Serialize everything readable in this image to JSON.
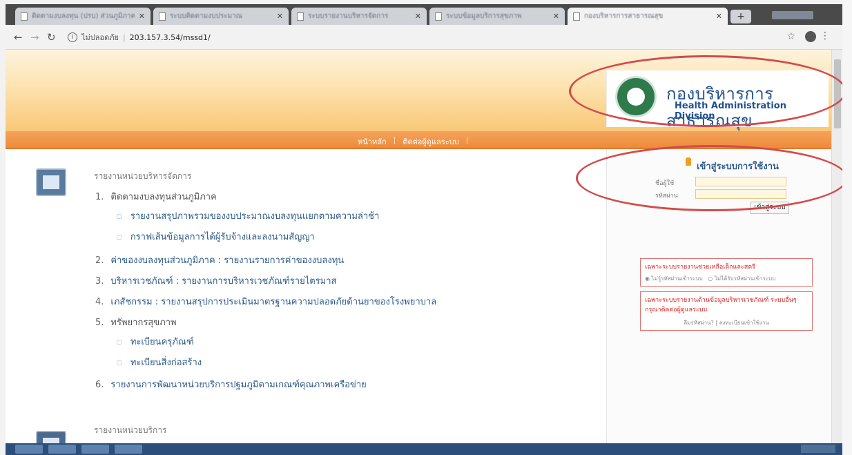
{
  "browser": {
    "tabs": [
      {
        "title": "ติดตามงบลงทุน (ปรบ) ส่วนภูมิภาค",
        "active": false
      },
      {
        "title": "ระบบติดตามงบประมาณ",
        "active": false
      },
      {
        "title": "ระบบรายงานบริหารจัดการ",
        "active": false
      },
      {
        "title": "ระบบข้อมูลบริการสุขภาพ",
        "active": false
      },
      {
        "title": "กองบริหารการสาธารณสุข",
        "active": true
      }
    ],
    "new_tab_glyph": "+",
    "address": {
      "security_label": "ไม่ปลอดภัย",
      "url": "203.157.3.54/mssd1/"
    }
  },
  "header": {
    "org_name_th": "กองบริหารการสาธารณสุข",
    "org_name_en": "Health Administration Division"
  },
  "nav": {
    "links": [
      "หน้าหลัก",
      "ติดต่อผู้ดูแลระบบ"
    ]
  },
  "main": {
    "section1_title": "รายงานหน่วยบริหารจัดการ",
    "items": [
      {
        "num": "1.",
        "label": "ติดตามงบลงทุนส่วนภูมิภาค",
        "link": false
      },
      {
        "num": "2.",
        "label": "ค่าของงบลงทุนส่วนภูมิภาค : รายงานรายการค่าของงบลงทุน",
        "link": true
      },
      {
        "num": "3.",
        "label": "บริหารเวชภัณฑ์ : รายงานการบริหารเวชภัณฑ์รายไตรมาส",
        "link": true
      },
      {
        "num": "4.",
        "label": "เภสัชกรรม : รายงานสรุปการประเมินมาตรฐานความปลอดภัยด้านยาของโรงพยาบาล",
        "link": true
      },
      {
        "num": "5.",
        "label": "ทรัพยากรสุขภาพ",
        "link": false
      },
      {
        "num": "6.",
        "label": "รายงานการพัฒนาหน่วยบริการปฐมภูมิตามเกณฑ์คุณภาพเครือข่าย",
        "link": true
      }
    ],
    "sub1": [
      "รายงานสรุปภาพรวมของงบประมาณงบลงทุนแยกตามความล่าช้า",
      "กราฟเส้นข้อมูลการได้ผู้รับจ้างและลงนามสัญญา"
    ],
    "sub5": [
      "ทะเบียนครุภัณฑ์",
      "ทะเบียนสิ่งก่อสร้าง"
    ],
    "section2_title": "รายงานหน่วยบริการ"
  },
  "login": {
    "title": "เข้าสู่ระบบการใช้งาน",
    "username_label": "ชื่อผู้ใช้",
    "password_label": "รหัสผ่าน",
    "submit_label": "เข้าสู่ระบบ"
  },
  "notices": {
    "n1_head": "เฉพาะระบบรายงานช่วยเหลือเด็กและสตรี",
    "n1_opt1": "ไม่รู้รหัสผ่านเข้าระบบ",
    "n1_opt2": "ไม่ได้รับรหัสผ่านเข้าระบบ",
    "n2_head": "เฉพาะระบบรายงานด้านข้อมูลบริหารเวชภัณฑ์ ระบบอื่นๆ กรุณาติดต่อผู้ดูแลระบบ",
    "n2_links": "ลืมรหัสผ่าน? | ลงทะเบียนเข้าใช้งาน"
  },
  "colors": {
    "banner_orange": "#f9c877",
    "nav_orange": "#ee8a3a",
    "link_blue": "#2b5a8a",
    "annotation_red": "#d44a4a",
    "seal_green": "#2f7a4b"
  }
}
